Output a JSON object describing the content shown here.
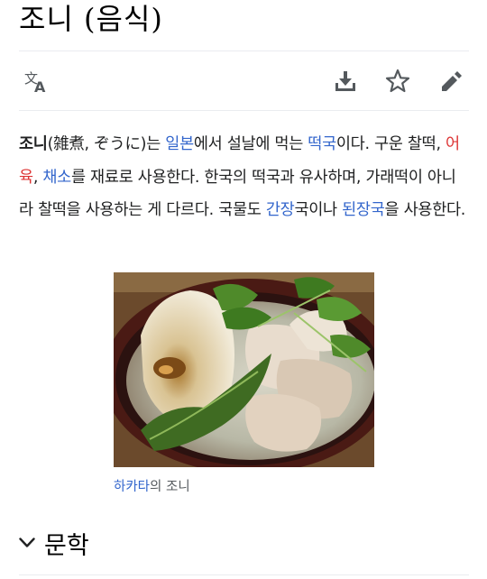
{
  "title": "조니 (음식)",
  "toolbar": {
    "language_icon": "translate-icon",
    "download_icon": "download-icon",
    "watch_icon": "star-icon",
    "edit_icon": "pencil-icon"
  },
  "lead": {
    "term": "조니",
    "p1": "(雑煮, ぞうに)는 ",
    "link_japan": "일본",
    "p2": "에서 설날에 먹는 ",
    "link_tteokguk": "떡국",
    "p3": "이다. 구운 찰떡, ",
    "link_fish": "어육",
    "p4": ", ",
    "link_veg": "채소",
    "p5": "를 재료로 사용한다. 한국의 떡국과 유사하며, 가래떡이 아니라 찰떡을 사용하는 게 다르다. 국물도 ",
    "link_ganjang": "간장",
    "p6": "국이나 ",
    "link_doenjang": "된장국",
    "p7": "을 사용한다."
  },
  "figure": {
    "caption_link": "하카타",
    "caption_text": "의 조니"
  },
  "section": {
    "title": "문학",
    "icon": "chevron-down-icon"
  },
  "colors": {
    "link": "#3366cc",
    "redlink": "#dd3333",
    "icon": "#54595d"
  }
}
